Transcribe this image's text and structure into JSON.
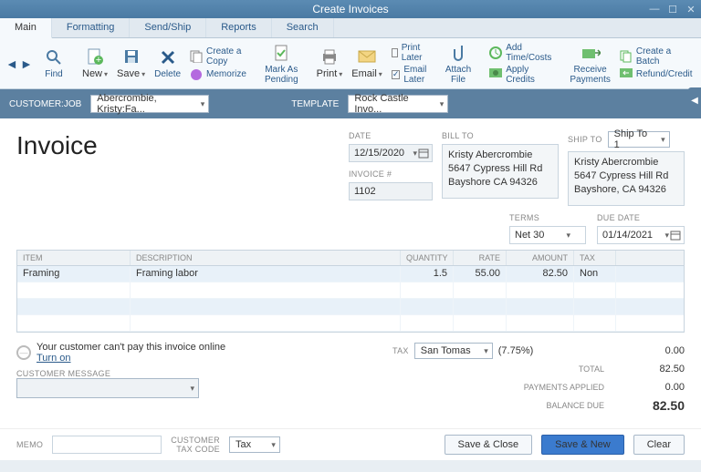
{
  "window": {
    "title": "Create Invoices"
  },
  "tabs": {
    "main": "Main",
    "formatting": "Formatting",
    "sendship": "Send/Ship",
    "reports": "Reports",
    "search": "Search"
  },
  "ribbon": {
    "find": "Find",
    "new": "New",
    "save": "Save",
    "delete": "Delete",
    "create_copy": "Create a Copy",
    "memorize": "Memorize",
    "mark_pending": "Mark As\nPending",
    "print": "Print",
    "email": "Email",
    "print_later": "Print Later",
    "email_later": "Email Later",
    "attach_file": "Attach\nFile",
    "add_time": "Add Time/Costs",
    "apply_credits": "Apply Credits",
    "receive_payments": "Receive\nPayments",
    "create_batch": "Create a Batch",
    "refund_credit": "Refund/Credit"
  },
  "bar": {
    "customer_label": "Customer:Job",
    "customer_value": "Abercrombie, Kristy:Fa...",
    "template_label": "Template",
    "template_value": "Rock Castle Invo..."
  },
  "invoice": {
    "heading": "Invoice",
    "labels": {
      "date": "Date",
      "invoice_no": "Invoice #",
      "bill_to": "Bill To",
      "ship_to": "Ship To",
      "terms": "Terms",
      "due_date": "Due Date"
    },
    "date": "12/15/2020",
    "number": "1102",
    "bill_to": "Kristy Abercrombie\n5647 Cypress Hill Rd\nBayshore CA 94326",
    "ship_to_sel": "Ship To 1",
    "ship_to": "Kristy Abercrombie\n5647 Cypress Hill Rd\nBayshore, CA 94326",
    "terms": "Net 30",
    "due_date": "01/14/2021"
  },
  "grid": {
    "hdr": {
      "item": "Item",
      "desc": "Description",
      "qty": "Quantity",
      "rate": "Rate",
      "amt": "Amount",
      "tax": "Tax"
    },
    "rows": [
      {
        "item": "Framing",
        "desc": "Framing labor",
        "qty": "1.5",
        "rate": "55.00",
        "amt": "82.50",
        "tax": "Non"
      }
    ]
  },
  "online": {
    "msg": "Your customer can't pay this invoice online",
    "link": "Turn on"
  },
  "cust_msg_label": "Customer Message",
  "memo_label": "Memo",
  "cust_tax_label": "Customer\nTax Code",
  "cust_tax_value": "Tax",
  "totals": {
    "tax_label": "Tax",
    "tax_code": "San Tomas",
    "tax_pct": "(7.75%)",
    "tax_amt": "0.00",
    "total_label": "Total",
    "total": "82.50",
    "pay_label": "Payments Applied",
    "pay": "0.00",
    "bal_label": "Balance Due",
    "bal": "82.50"
  },
  "buttons": {
    "save_close": "Save & Close",
    "save_new": "Save & New",
    "clear": "Clear"
  }
}
